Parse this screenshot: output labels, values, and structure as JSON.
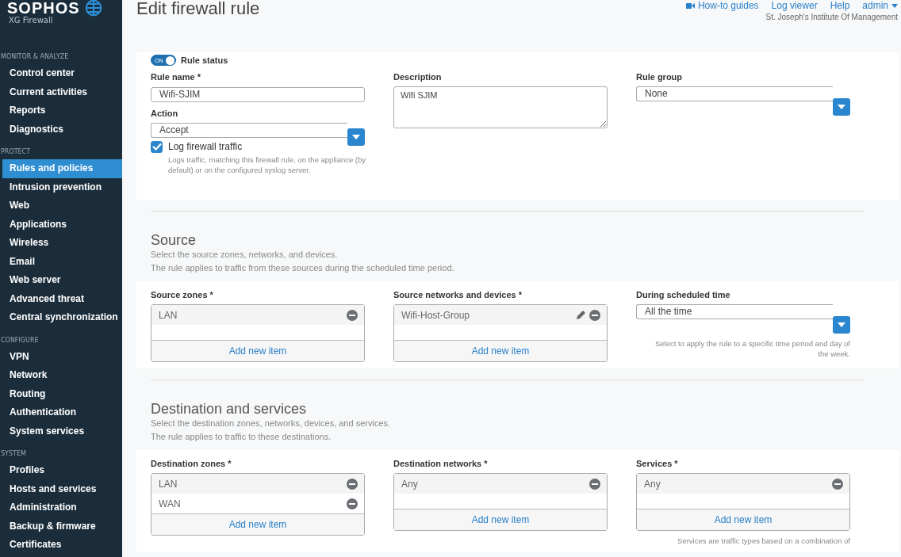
{
  "sidebar": {
    "logo": "SOPHOS",
    "product": "XG Firewall",
    "sections": [
      {
        "title": "MONITOR & ANALYZE",
        "items": [
          {
            "label": "Control center",
            "selected": false
          },
          {
            "label": "Current activities",
            "selected": false
          },
          {
            "label": "Reports",
            "selected": false
          },
          {
            "label": "Diagnostics",
            "selected": false
          }
        ]
      },
      {
        "title": "PROTECT",
        "items": [
          {
            "label": "Rules and policies",
            "selected": true
          },
          {
            "label": "Intrusion prevention",
            "selected": false
          },
          {
            "label": "Web",
            "selected": false
          },
          {
            "label": "Applications",
            "selected": false
          },
          {
            "label": "Wireless",
            "selected": false
          },
          {
            "label": "Email",
            "selected": false
          },
          {
            "label": "Web server",
            "selected": false
          },
          {
            "label": "Advanced threat",
            "selected": false
          },
          {
            "label": "Central synchronization",
            "selected": false
          }
        ]
      },
      {
        "title": "CONFIGURE",
        "items": [
          {
            "label": "VPN",
            "selected": false
          },
          {
            "label": "Network",
            "selected": false
          },
          {
            "label": "Routing",
            "selected": false
          },
          {
            "label": "Authentication",
            "selected": false
          },
          {
            "label": "System services",
            "selected": false
          }
        ]
      },
      {
        "title": "SYSTEM",
        "items": [
          {
            "label": "Profiles",
            "selected": false
          },
          {
            "label": "Hosts and services",
            "selected": false
          },
          {
            "label": "Administration",
            "selected": false
          },
          {
            "label": "Backup & firmware",
            "selected": false
          },
          {
            "label": "Certificates",
            "selected": false
          }
        ]
      }
    ]
  },
  "header": {
    "links": [
      {
        "label": "How-to guides",
        "kind": "video"
      },
      {
        "label": "Log viewer",
        "kind": "plain"
      },
      {
        "label": "Help",
        "kind": "plain"
      },
      {
        "label": "admin",
        "kind": "menu"
      }
    ],
    "org": "St. Joseph's Institute Of Management"
  },
  "title": "Edit firewall rule",
  "rule": {
    "status": {
      "label": "Rule status",
      "on": true,
      "on_text": "ON"
    },
    "rule_name": {
      "label": "Rule name *",
      "value": "Wifi-SJIM"
    },
    "action": {
      "label": "Action",
      "value": "Accept"
    },
    "log": {
      "label": "Log firewall traffic",
      "checked": true,
      "hint": "Logs traffic, matching this firewall rule, on the appliance (by default) or on the configured syslog server."
    },
    "description": {
      "label": "Description",
      "value": "Wifi SJIM"
    },
    "rule_group": {
      "label": "Rule group",
      "value": "None"
    }
  },
  "sections": [
    {
      "title": "Source",
      "lines": [
        "Select the source zones, networks, and devices.",
        "The rule applies to traffic from these sources during the scheduled time period."
      ],
      "fields": [
        {
          "kind": "list",
          "label": "Source zones *",
          "items": [
            {
              "label": "LAN",
              "editable": false
            }
          ],
          "add": "Add new item"
        },
        {
          "kind": "list",
          "label": "Source networks and devices *",
          "items": [
            {
              "label": "Wifi-Host-Group",
              "editable": true
            }
          ],
          "add": "Add new item"
        },
        {
          "kind": "select",
          "label": "During scheduled time",
          "value": "All the time",
          "hint": "Select to apply the rule to a specific time period and day of the week."
        }
      ]
    },
    {
      "title": "Destination and services",
      "lines": [
        "Select the destination zones, networks, devices, and services.",
        "The rule applies to traffic to these destinations."
      ],
      "fields": [
        {
          "kind": "list",
          "label": "Destination zones *",
          "items": [
            {
              "label": "LAN",
              "editable": false
            },
            {
              "label": "WAN",
              "editable": false
            }
          ],
          "add": "Add new item"
        },
        {
          "kind": "list",
          "label": "Destination networks *",
          "items": [
            {
              "label": "Any",
              "editable": false
            }
          ],
          "add": "Add new item"
        },
        {
          "kind": "list",
          "label": "Services *",
          "items": [
            {
              "label": "Any",
              "editable": false
            }
          ],
          "add": "Add new item",
          "hint": "Services are traffic types based on a combination of"
        }
      ]
    }
  ]
}
